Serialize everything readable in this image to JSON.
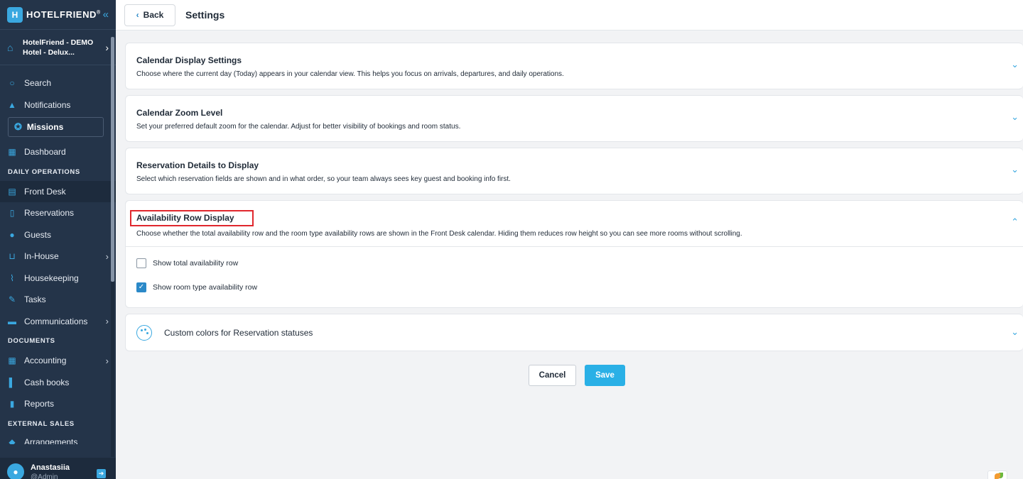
{
  "brand": {
    "name": "HOTELFRIEND",
    "mark": "®"
  },
  "hotel": {
    "name": "HotelFriend - DEMO Hotel - Delux..."
  },
  "nav": {
    "search": "Search",
    "notifications": "Notifications",
    "missions": "Missions",
    "dashboard": "Dashboard",
    "section_daily": "DAILY OPERATIONS",
    "front_desk": "Front Desk",
    "reservations": "Reservations",
    "guests": "Guests",
    "in_house": "In-House",
    "housekeeping": "Housekeeping",
    "tasks": "Tasks",
    "communications": "Communications",
    "section_documents": "DOCUMENTS",
    "accounting": "Accounting",
    "cash_books": "Cash books",
    "reports": "Reports",
    "section_external": "EXTERNAL SALES",
    "arrangements": "Arrangements"
  },
  "user": {
    "name": "Anastasiia",
    "role": "@Admin"
  },
  "header": {
    "back": "Back",
    "title": "Settings"
  },
  "cards": {
    "calendar_display": {
      "title": "Calendar Display Settings",
      "desc": "Choose where the current day (Today) appears in your calendar view. This helps you focus on arrivals, departures, and daily operations."
    },
    "zoom": {
      "title": "Calendar Zoom Level",
      "desc": "Set your preferred default zoom for the calendar. Adjust for better visibility of bookings and room status."
    },
    "reservation_details": {
      "title": "Reservation Details to Display",
      "desc": "Select which reservation fields are shown and in what order, so your team always sees key guest and booking info first."
    },
    "availability": {
      "title": "Availability Row Display",
      "desc": "Choose whether the total availability row and the room type availability rows are shown in the Front Desk calendar. Hiding them reduces row height so you can see more rooms without scrolling.",
      "options": [
        {
          "label": "Show total availability row",
          "checked": false
        },
        {
          "label": "Show room type availability row",
          "checked": true
        }
      ]
    },
    "custom_colors": {
      "title": "Custom colors for Reservation statuses"
    }
  },
  "actions": {
    "cancel": "Cancel",
    "save": "Save"
  },
  "colors": {
    "accent": "#2ab0e6",
    "sidebar": "#243449",
    "highlight": "#e0272d"
  }
}
